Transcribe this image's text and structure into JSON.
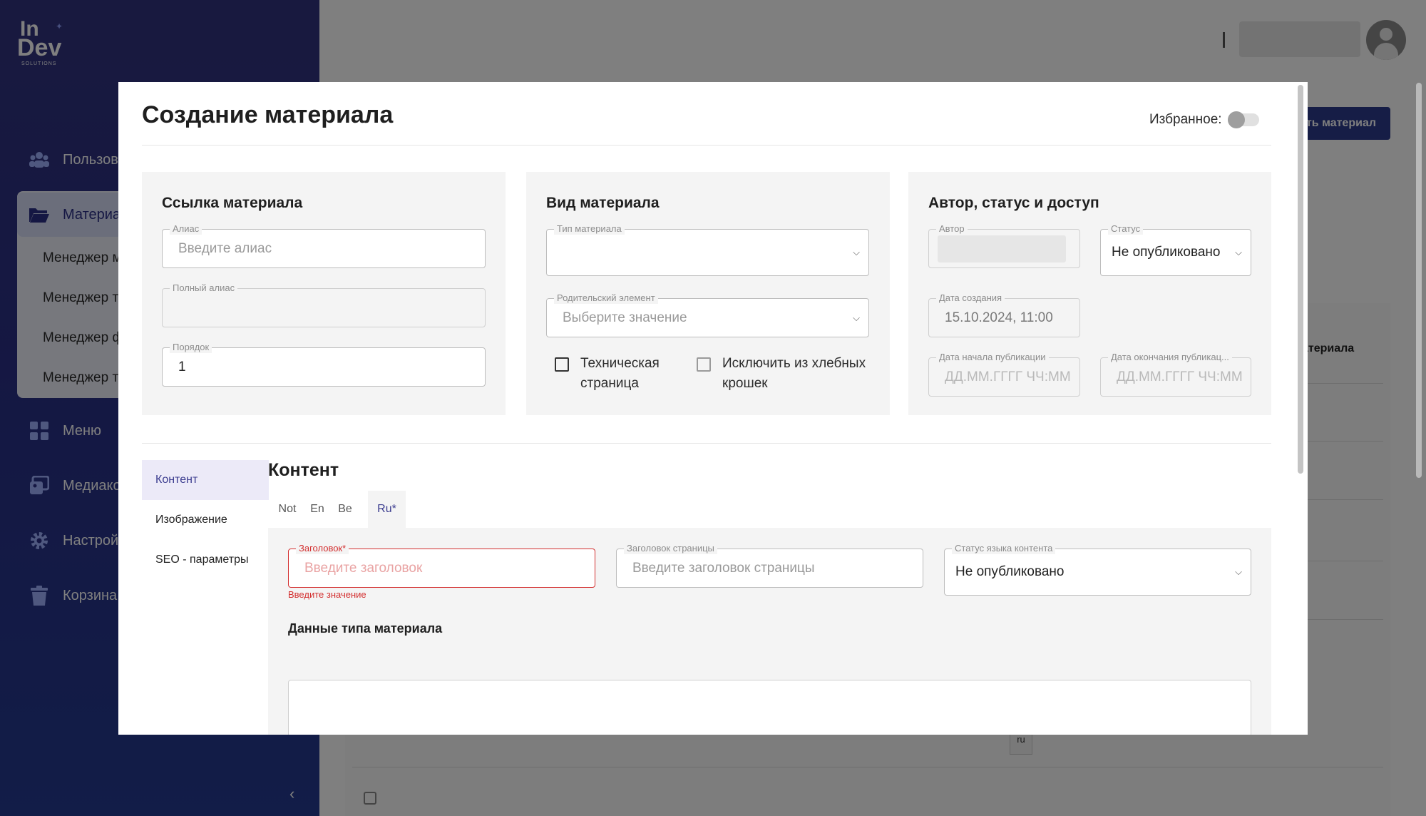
{
  "app": {
    "logo": {
      "line1": "In",
      "line2": "Dev",
      "line3": "SOLUTIONS"
    },
    "sidebar": {
      "items": [
        {
          "label": "Пользова",
          "icon": "users-icon"
        },
        {
          "label": "Материа",
          "icon": "folder-icon"
        },
        {
          "label": "Меню",
          "icon": "grid-icon"
        },
        {
          "label": "Медиако",
          "icon": "media-icon"
        },
        {
          "label": "Настрой",
          "icon": "gear-icon"
        },
        {
          "label": "Корзина",
          "icon": "trash-icon"
        }
      ],
      "subitems": [
        "Менеджер м",
        "Менеджер т",
        "Менеджер ф",
        "Менеджер т"
      ],
      "collapse_glyph": "‹"
    },
    "header": {
      "create_button": "ть материал"
    },
    "table": {
      "column_label": "атериала",
      "tag": "ru"
    }
  },
  "modal": {
    "title": "Создание материала",
    "favorite_label": "Избранное:",
    "favorite_on": false,
    "link_card": {
      "title": "Ссылка материала",
      "alias": {
        "label": "Алиас",
        "placeholder": "Введите алиас",
        "value": ""
      },
      "full_alias": {
        "label": "Полный алиас",
        "value": ""
      },
      "order": {
        "label": "Порядок",
        "value": "1"
      }
    },
    "type_card": {
      "title": "Вид материала",
      "material_type": {
        "label": "Тип материала",
        "value": ""
      },
      "parent": {
        "label": "Родительский элемент",
        "placeholder": "Выберите значение"
      },
      "technical_page": {
        "label": "Техническая страница",
        "checked": false
      },
      "exclude_breadcrumbs": {
        "label": "Исключить из хлебных крошек",
        "checked": false
      }
    },
    "author_card": {
      "title": "Автор, статус и доступ",
      "author": {
        "label": "Автор"
      },
      "status": {
        "label": "Статус",
        "value": "Не опубликовано"
      },
      "created": {
        "label": "Дата создания",
        "value": "15.10.2024, 11:00"
      },
      "publish_start": {
        "label": "Дата начала публикации",
        "placeholder": "ДД.ММ.ГГГГ ЧЧ:ММ"
      },
      "publish_end": {
        "label": "Дата окончания публикац...",
        "placeholder": "ДД.ММ.ГГГГ ЧЧ:ММ"
      }
    },
    "side_tabs": [
      "Контент",
      "Изображение",
      "SEO - параметры"
    ],
    "active_side_tab": "Контент",
    "content": {
      "title": "Контент",
      "lang_tabs": [
        "Not",
        "En",
        "Be",
        "Ru*"
      ],
      "active_lang": "Ru*",
      "heading": {
        "label": "Заголовок*",
        "placeholder": "Введите заголовок",
        "error": "Введите значение"
      },
      "page_heading": {
        "label": "Заголовок страницы",
        "placeholder": "Введите заголовок страницы"
      },
      "lang_status": {
        "label": "Статус языка контента",
        "value": "Не опубликовано"
      },
      "type_data_title": "Данные типа материала"
    }
  },
  "colors": {
    "sidebar": "#2a2f86",
    "accent": "#3b3c8f",
    "error": "#d32f2f",
    "panel": "#f4f4f4"
  }
}
